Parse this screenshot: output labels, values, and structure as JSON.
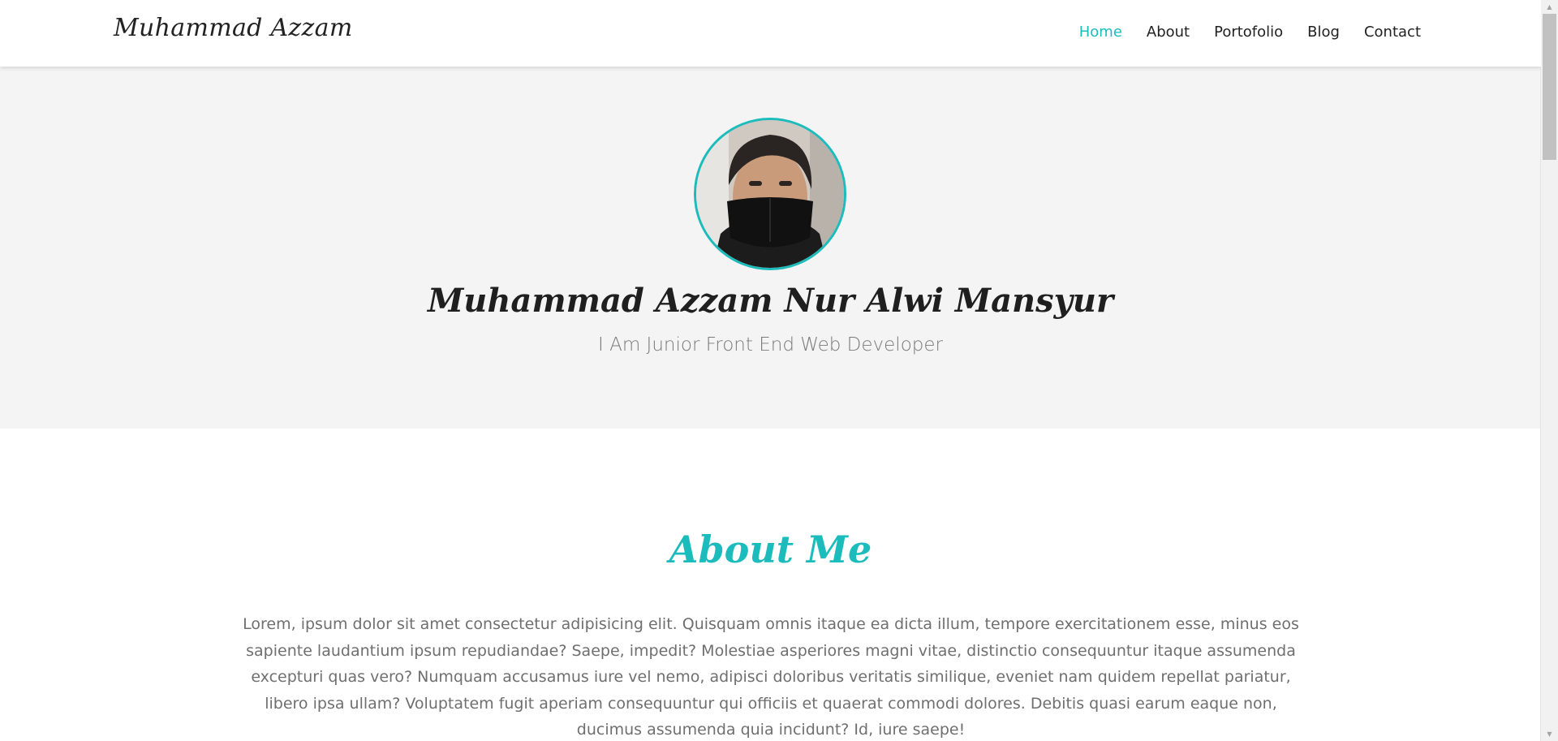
{
  "navbar": {
    "brand": "Muhammad Azzam",
    "links": [
      {
        "label": "Home",
        "active": true
      },
      {
        "label": "About",
        "active": false
      },
      {
        "label": "Portofolio",
        "active": false
      },
      {
        "label": "Blog",
        "active": false
      },
      {
        "label": "Contact",
        "active": false
      }
    ]
  },
  "hero": {
    "name": "Muhammad Azzam Nur Alwi Mansyur",
    "subtitle": "I Am Junior Front End Web Developer",
    "avatar_icon": "profile-photo"
  },
  "about": {
    "title": "About Me",
    "text": "Lorem, ipsum dolor sit amet consectetur adipisicing elit. Quisquam omnis itaque ea dicta illum, tempore exercitationem esse, minus eos sapiente laudantium ipsum repudiandae? Saepe, impedit? Molestiae asperiores magni vitae, distinctio consequuntur itaque assumenda excepturi quas vero? Numquam accusamus iure vel nemo, adipisci doloribus veritatis similique, eveniet nam quidem repellat pariatur, libero ipsa ullam? Voluptatem fugit aperiam consequuntur qui officiis et quaerat commodi dolores. Debitis quasi earum eaque non, ducimus assumenda quia incidunt? Id, iure saepe!"
  },
  "colors": {
    "accent": "#1cbcbc",
    "hero_bg": "#f4f4f4",
    "text_dark": "#222222",
    "text_muted": "#6f6f6f"
  }
}
